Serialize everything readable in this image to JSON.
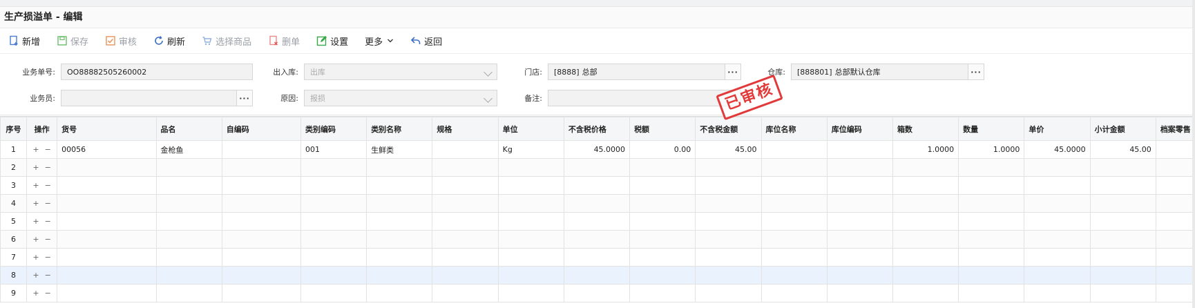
{
  "title": "生产损溢单 - 编辑",
  "toolbar": {
    "buttons": [
      {
        "label": "新增",
        "icon": "document-add-icon",
        "disabled": false
      },
      {
        "label": "保存",
        "icon": "save-icon",
        "disabled": true
      },
      {
        "label": "审核",
        "icon": "check-icon",
        "disabled": true
      },
      {
        "label": "刷新",
        "icon": "refresh-icon",
        "disabled": false
      },
      {
        "label": "选择商品",
        "icon": "cart-icon",
        "disabled": true
      },
      {
        "label": "删单",
        "icon": "delete-icon",
        "disabled": true
      },
      {
        "label": "设置",
        "icon": "edit-icon",
        "disabled": false
      },
      {
        "label": "更多",
        "icon": "chevron-down-icon",
        "disabled": false
      },
      {
        "label": "返回",
        "icon": "back-icon",
        "disabled": false
      }
    ]
  },
  "form": {
    "order_no_label": "业务单号:",
    "order_no_value": "OO88882505260002",
    "inout_label": "出入库:",
    "inout_value": "出库",
    "store_label": "门店:",
    "store_code": "[8888]",
    "store_name": "总部",
    "warehouse_label": "仓库:",
    "warehouse_code": "[888801]",
    "warehouse_name": "总部默认仓库",
    "staff_label": "业务员:",
    "staff_value": "",
    "reason_label": "原因:",
    "reason_value": "报损",
    "remark_label": "备注:",
    "remark_value": "",
    "ellipsis": "···"
  },
  "stamp": {
    "text": "已审核",
    "color": "#e23a3a"
  },
  "table": {
    "columns": [
      "序号",
      "操作",
      "货号",
      "品名",
      "自编码",
      "类别编码",
      "类别名称",
      "规格",
      "单位",
      "不含税价格",
      "税额",
      "不含税金额",
      "库位名称",
      "库位编码",
      "箱数",
      "数量",
      "单价",
      "小计金额",
      "档案零售"
    ],
    "rows": [
      {
        "seq": "1",
        "sku": "00056",
        "name": "金枪鱼",
        "selfcode": "",
        "catcode": "001",
        "catname": "生鲜类",
        "spec": "",
        "unit": "Kg",
        "price_ex": "45.0000",
        "tax": "0.00",
        "amount_ex": "45.00",
        "locname": "",
        "loccode": "",
        "boxes": "1.0000",
        "qty": "1.0000",
        "unit_price": "45.0000",
        "subtotal": "45.00",
        "retail": ""
      },
      {
        "seq": "2"
      },
      {
        "seq": "3"
      },
      {
        "seq": "4"
      },
      {
        "seq": "5"
      },
      {
        "seq": "6"
      },
      {
        "seq": "7"
      },
      {
        "seq": "8"
      },
      {
        "seq": "9"
      }
    ],
    "op_add": "+",
    "op_remove": "−",
    "selected_row": 8
  }
}
